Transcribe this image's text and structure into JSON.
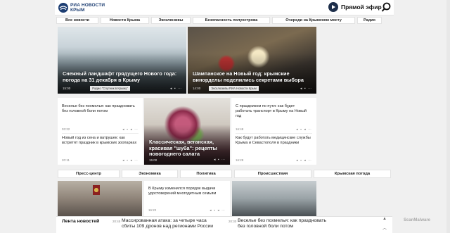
{
  "header": {
    "logo_line1": "РИА НОВОСТИ",
    "logo_line2": "КРЫМ",
    "live_label": "Прямой эфир"
  },
  "nav": {
    "items": [
      "Все новости",
      "Новости Крыма",
      "Эксклюзивы",
      "Безопасность полуострова",
      "Очереди на Крымском мосту",
      "Радио"
    ]
  },
  "cards": {
    "snow": {
      "title": "Снежный ландшафт грядущего Нового года: погода на 31 декабря в Крыму",
      "time": "15:00",
      "tag": "Радио \"Спутник в Крыму\""
    },
    "champ": {
      "title": "Шампанское на Новый год: крымские винорделы поделились секретами выбора",
      "time": "14:00",
      "tag": "Эксклюзивы РИА Новости Крым"
    },
    "salad": {
      "title": "Классическая, веганская, красивая \"шуба\": рецепты новогоднего салата",
      "time": "15:00"
    }
  },
  "left_news": [
    {
      "title": "Веселье без похмелья: как праздновать без головной боли потом",
      "time": "03:32"
    },
    {
      "title": "Новый год из сена и ватрушек: как встретят праздник в крымских зоопарках",
      "time": "20:11"
    }
  ],
  "right_news": [
    {
      "title": "С праздником по пути: как будет работать транспорт в Крыму на Новый год",
      "time": "16:48"
    },
    {
      "title": "Как будут работать медицинские службы Крыма и Севастополя в праздники",
      "time": "16:28"
    }
  ],
  "nav2": {
    "items": [
      "Пресс-центр",
      "Экономика",
      "Политика",
      "Происшествия",
      "Крымская погода"
    ]
  },
  "mid_news": {
    "title": "В Крыму изменился порядок выдачи удостоверений многодетным семьям",
    "time": "16:22"
  },
  "feed": {
    "label": "Лента новостей",
    "items": [
      {
        "time": "20:45",
        "text": "Массированная атака: за четыре часа сбиты 109 дронов над регионами России"
      },
      {
        "time": "20:30",
        "text": "Веселье без похмелья: как праздновать без головной боли потом"
      }
    ]
  },
  "watermark": "ScanMalware",
  "colors": {
    "brand": "#1d3e72",
    "background": "#f0f0f0"
  }
}
